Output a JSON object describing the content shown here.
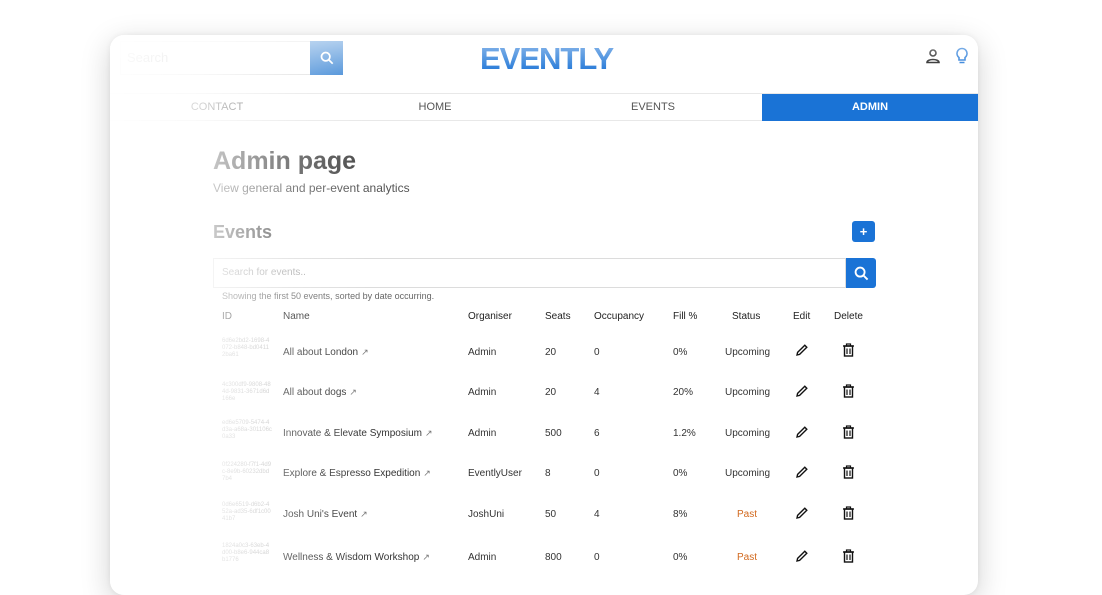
{
  "header": {
    "search_placeholder": "Search",
    "logo": "EVENTLY"
  },
  "nav": {
    "items": [
      {
        "label": "CONTACT"
      },
      {
        "label": "HOME"
      },
      {
        "label": "EVENTS"
      },
      {
        "label": "ADMIN",
        "active": true
      }
    ]
  },
  "page": {
    "title": "Admin page",
    "subtitle": "View general and per-event analytics"
  },
  "events": {
    "heading": "Events",
    "add_label": "+",
    "search_placeholder": "Search for events..",
    "showing_text": "Showing the first 50 events, sorted by date occurring.",
    "columns": [
      "ID",
      "Name",
      "Organiser",
      "Seats",
      "Occupancy",
      "Fill %",
      "Status",
      "Edit",
      "Delete"
    ],
    "rows": [
      {
        "id": "6d6e2bd2-1698-4072-b848-bd04112ba61",
        "name": "All about London",
        "organiser": "Admin",
        "seats": "20",
        "occupancy": "0",
        "fill": "0%",
        "status": "Upcoming"
      },
      {
        "id": "4c300df9-9808-484d-9831-3671d6d166e",
        "name": "All about dogs",
        "organiser": "Admin",
        "seats": "20",
        "occupancy": "4",
        "fill": "20%",
        "status": "Upcoming"
      },
      {
        "id": "ed6e5709-5474-4d3a-a68a-301106c0a33",
        "name": "Innovate & Elevate Symposium",
        "organiser": "Admin",
        "seats": "500",
        "occupancy": "6",
        "fill": "1.2%",
        "status": "Upcoming"
      },
      {
        "id": "0f224280-f7f1-4d9c-8e9b-60232dbd7b4",
        "name": "Explore & Espresso Expedition",
        "organiser": "EventlyUser",
        "seats": "8",
        "occupancy": "0",
        "fill": "0%",
        "status": "Upcoming"
      },
      {
        "id": "0d6e6519-d6b2-452a-ad35-6df1c0041b7",
        "name": "Josh Uni's Event",
        "organiser": "JoshUni",
        "seats": "50",
        "occupancy": "4",
        "fill": "8%",
        "status": "Past"
      },
      {
        "id": "1824a0c3-63eb-4d00-b8e6-944ca8b1776",
        "name": "Wellness & Wisdom Workshop",
        "organiser": "Admin",
        "seats": "800",
        "occupancy": "0",
        "fill": "0%",
        "status": "Past"
      }
    ]
  },
  "colors": {
    "accent": "#1a73d6",
    "past_status": "#d2691e"
  },
  "icons": {
    "search": "search-icon",
    "user": "user-icon",
    "bulb": "lightbulb-icon",
    "external": "external-link-icon",
    "edit": "pencil-icon",
    "delete": "trash-icon"
  }
}
